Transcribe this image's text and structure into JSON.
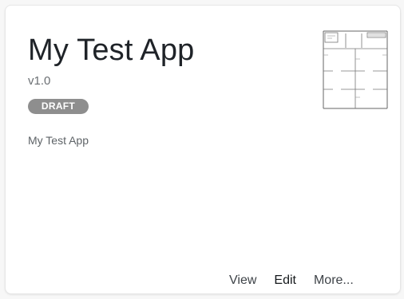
{
  "card": {
    "title": "My Test App",
    "version": "v1.0",
    "status_badge": "DRAFT",
    "description": "My Test App",
    "thumbnail": {
      "icon": "floorplan-thumbnail"
    }
  },
  "actions": {
    "view_label": "View",
    "edit_label": "Edit",
    "more_label": "More..."
  },
  "colors": {
    "badge_bg": "#8e8e8e",
    "title_text": "#1f2328",
    "muted_text": "#6b6f73"
  }
}
